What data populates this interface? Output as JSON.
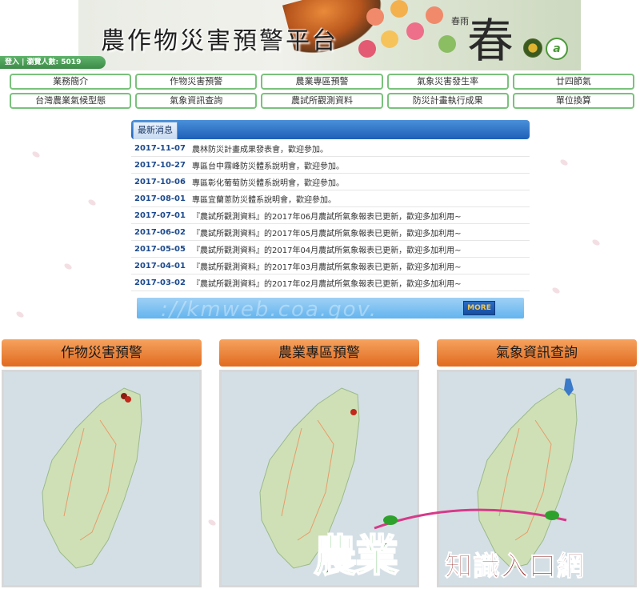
{
  "banner": {
    "title": "農作物災害預警平台",
    "spring_char": "春",
    "poem": "春雨"
  },
  "login_bar": {
    "text": "登入 | 瀏覽人數: 5019"
  },
  "nav": {
    "items": [
      {
        "label": "業務簡介"
      },
      {
        "label": "作物災害預警"
      },
      {
        "label": "農業專區預警"
      },
      {
        "label": "氣象災害發生率"
      },
      {
        "label": "廿四節氣"
      },
      {
        "label": "台灣農業氣候型態"
      },
      {
        "label": "氣象資訊查詢"
      },
      {
        "label": "農試所觀測資料"
      },
      {
        "label": "防災計畫執行成果"
      },
      {
        "label": "單位換算"
      }
    ]
  },
  "news": {
    "tab_label": "最新消息",
    "items": [
      {
        "date": "2017-11-07",
        "title": "農林防災計畫成果發表會，歡迎參加。"
      },
      {
        "date": "2017-10-27",
        "title": "專區台中霧峰防災體系說明會，歡迎參加。"
      },
      {
        "date": "2017-10-06",
        "title": "專區彰化葡萄防災體系說明會，歡迎參加。"
      },
      {
        "date": "2017-08-01",
        "title": "專區宜蘭蔥防災體系說明會，歡迎參加。"
      },
      {
        "date": "2017-07-01",
        "title": "『農試所觀測資料』的2017年06月農試所氣象報表已更新，歡迎多加利用~"
      },
      {
        "date": "2017-06-02",
        "title": "『農試所觀測資料』的2017年05月農試所氣象報表已更新，歡迎多加利用~"
      },
      {
        "date": "2017-05-05",
        "title": "『農試所觀測資料』的2017年04月農試所氣象報表已更新，歡迎多加利用~"
      },
      {
        "date": "2017-04-01",
        "title": "『農試所觀測資料』的2017年03月農試所氣象報表已更新，歡迎多加利用~"
      },
      {
        "date": "2017-03-02",
        "title": "『農試所觀測資料』的2017年02月農試所氣象報表已更新，歡迎多加利用~"
      }
    ],
    "more_label": "MORE",
    "watermark": "://kmweb.coa.gov."
  },
  "cards": [
    {
      "title": "作物災害預警"
    },
    {
      "title": "農業專區預警"
    },
    {
      "title": "氣象資訊查詢"
    }
  ],
  "brand": {
    "big": "農業",
    "small": "知識入口網"
  },
  "colors": {
    "nav_border": "#79c27b",
    "news_header": "#1e60b8",
    "date_text": "#1c4a8e",
    "card_orange": "#e06b1f",
    "brand_green": "#2ea12d",
    "brand_red": "#8a1a1a"
  }
}
